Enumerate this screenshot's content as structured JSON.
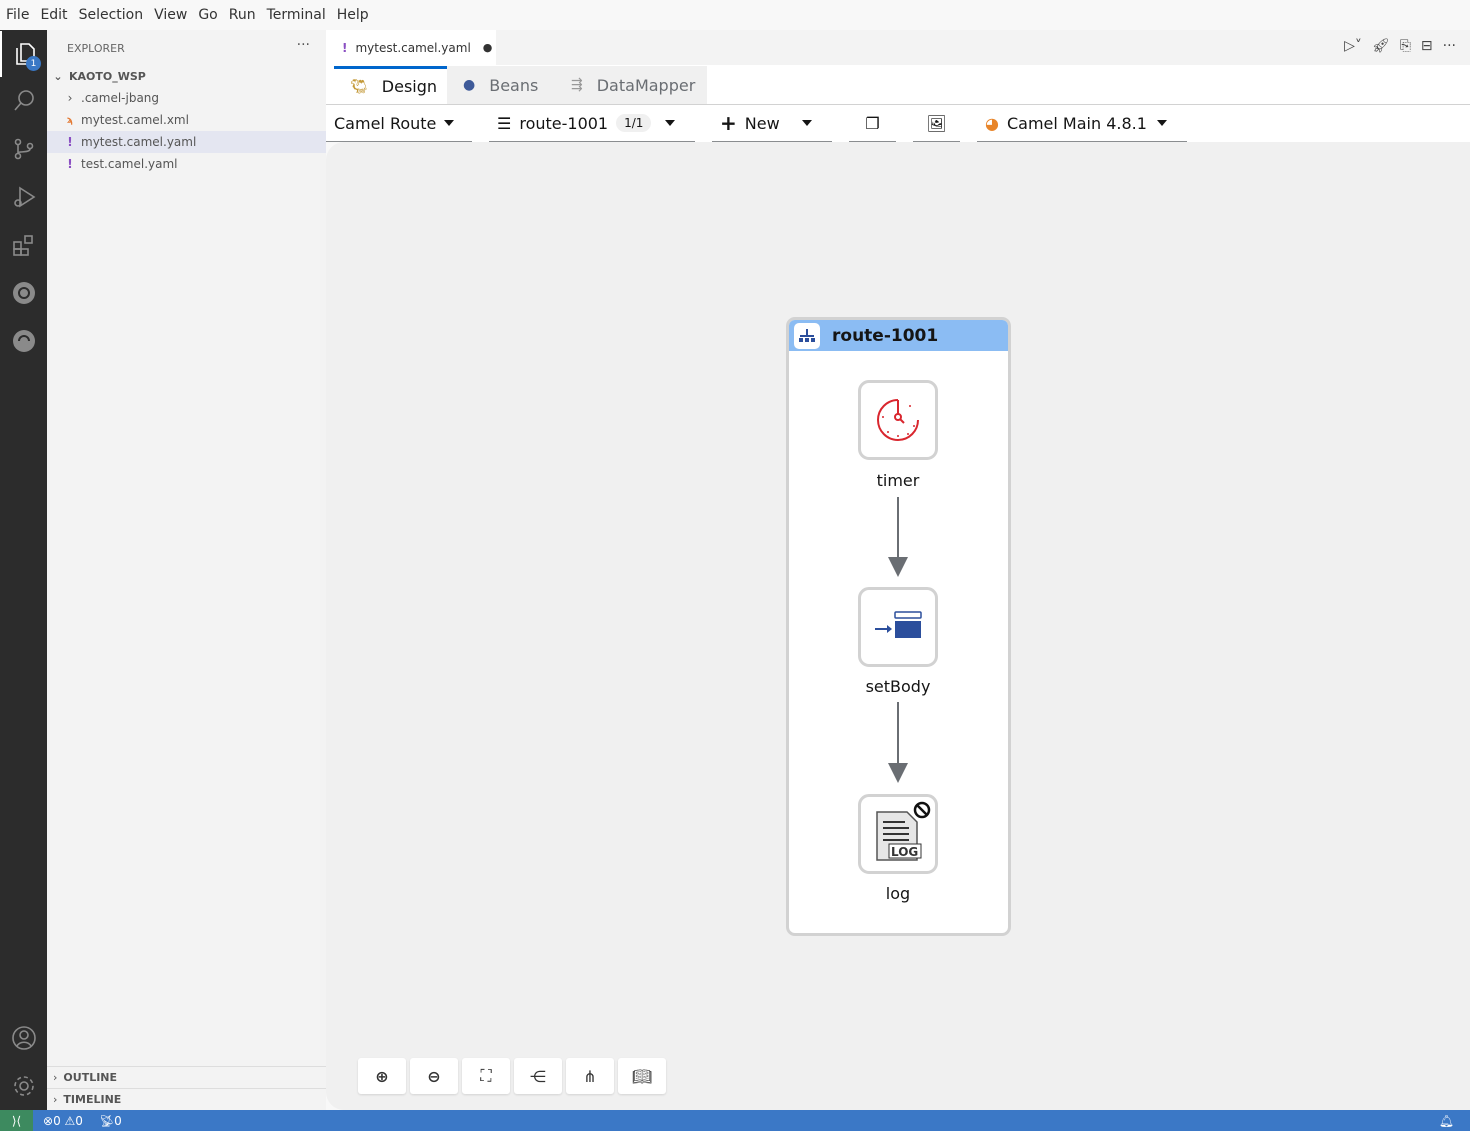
{
  "menu": [
    "File",
    "Edit",
    "Selection",
    "View",
    "Go",
    "Run",
    "Terminal",
    "Help"
  ],
  "activity": {
    "explorer_badge": "1"
  },
  "explorer": {
    "title": "EXPLORER",
    "more": "···",
    "workspace": "KAOTO_WSP",
    "items": [
      {
        "label": ".camel-jbang",
        "icon": "chevron-right"
      },
      {
        "label": "mytest.camel.xml",
        "icon": "rss"
      },
      {
        "label": "mytest.camel.yaml",
        "icon": "!"
      },
      {
        "label": "test.camel.yaml",
        "icon": "!"
      }
    ],
    "outline": "OUTLINE",
    "timeline": "TIMELINE"
  },
  "editor_tab": {
    "icon": "!",
    "label": "mytest.camel.yaml",
    "dirty": "●"
  },
  "kaoto_tabs": [
    {
      "label": "Design"
    },
    {
      "label": "Beans"
    },
    {
      "label": "DataMapper"
    }
  ],
  "toolbar": {
    "type_select": "Camel Route",
    "route_select": "route-1001",
    "route_count": "1/1",
    "new_label": "New",
    "runtime": "Camel Main 4.8.1"
  },
  "route": {
    "title": "route-1001",
    "nodes": [
      {
        "label": "timer"
      },
      {
        "label": "setBody"
      },
      {
        "label": "log"
      }
    ],
    "colors": {
      "header": "#8bbcf3",
      "timer": "#d9262e",
      "setbody": "#2b4e9c"
    }
  },
  "status": {
    "errors": "0",
    "warnings": "0",
    "ports": "0"
  }
}
